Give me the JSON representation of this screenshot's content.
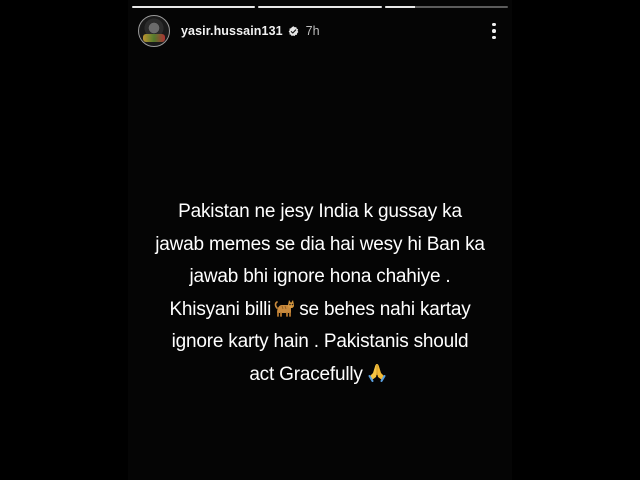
{
  "story": {
    "progress_segments": [
      {
        "fill": 1.0
      },
      {
        "fill": 1.0
      },
      {
        "fill": 0.25
      }
    ]
  },
  "header": {
    "username": "yasir.hussain131",
    "timestamp": "7h",
    "avatar_icon": "avatar",
    "verified_icon": "verified-badge-icon",
    "more_icon": "more-vertical-icon"
  },
  "caption": {
    "line1": "Pakistan ne jesy India k gussay ka",
    "line2": "jawab memes se dia hai wesy hi Ban ka",
    "line3": "jawab bhi ignore hona chahiye .",
    "line4_before": "Khisyani billi",
    "line4_after": "se behes nahi kartay",
    "line5": "ignore karty hain . Pakistanis should",
    "line6": "act Gracefully",
    "emoji_cat": "cat-emoji-icon",
    "emoji_pray": "folded-hands-emoji-icon"
  }
}
